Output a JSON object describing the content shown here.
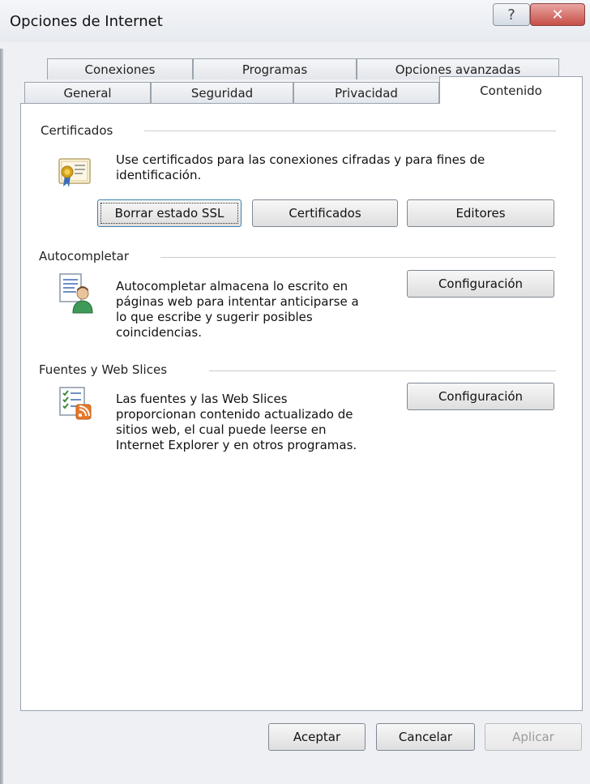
{
  "window": {
    "title": "Opciones de Internet",
    "help_glyph": "?",
    "close_glyph": "✕"
  },
  "tabs": {
    "row1": [
      "Conexiones",
      "Programas",
      "Opciones avanzadas"
    ],
    "row2": [
      "General",
      "Seguridad",
      "Privacidad",
      "Contenido"
    ],
    "active": "Contenido"
  },
  "certificados": {
    "heading": "Certificados",
    "description_line1": "Use certificados para las conexiones cifradas y para fines de",
    "description_line2": "identificación.",
    "icon": "certificate-icon",
    "buttons": [
      "Borrar estado SSL",
      "Certificados",
      "Editores"
    ]
  },
  "autocompletar": {
    "heading": "Autocompletar",
    "description_lines": [
      "Autocompletar almacena lo escrito en",
      "páginas web para intentar anticiparse a",
      "lo que escribe y sugerir posibles",
      "coincidencias."
    ],
    "icon": "autocomplete-user-icon",
    "button": "Configuración"
  },
  "fuentes": {
    "heading": "Fuentes y Web Slices",
    "description_lines": [
      "Las fuentes y las Web Slices",
      "proporcionan contenido actualizado de",
      "sitios web, el cual puede leerse en",
      "Internet Explorer y en otros programas."
    ],
    "icon": "feeds-rss-icon",
    "button": "Configuración"
  },
  "footer": {
    "accept": "Aceptar",
    "cancel": "Cancelar",
    "apply": "Aplicar"
  },
  "colors": {
    "rss_orange": "#e8792b",
    "certificate_seal": "#d6a21c",
    "close_red": "#c64f47"
  }
}
